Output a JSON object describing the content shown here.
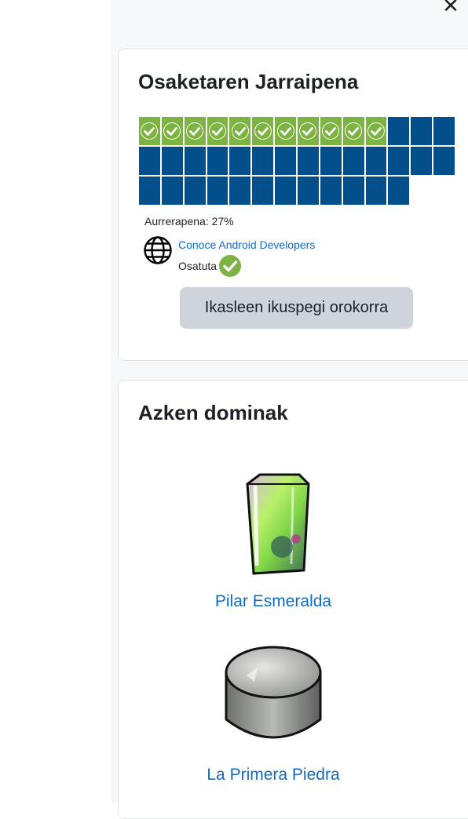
{
  "drawer": {
    "close_icon": "close-icon"
  },
  "progress": {
    "title": "Osaketaren Jarraipena",
    "total_activities": 40,
    "completed_activities": 11,
    "progress_label": "Aurrerapena: 27%",
    "activity": {
      "icon": "globe-icon",
      "name": "Conoce Android Developers",
      "status": "Osatuta"
    },
    "overview_button": "Ikasleen ikuspegi orokorra",
    "colors": {
      "completed": "#7cb342",
      "not_completed": "#034f8b"
    }
  },
  "badges": {
    "title": "Azken dominak",
    "items": [
      {
        "name": "Pilar Esmeralda",
        "icon": "emerald-pillar-badge"
      },
      {
        "name": "La Primera Piedra",
        "icon": "stone-badge"
      }
    ]
  },
  "colors": {
    "link": "#0f6cbf",
    "button_bg": "#ced4da",
    "page_bg": "#f7f8f9"
  }
}
